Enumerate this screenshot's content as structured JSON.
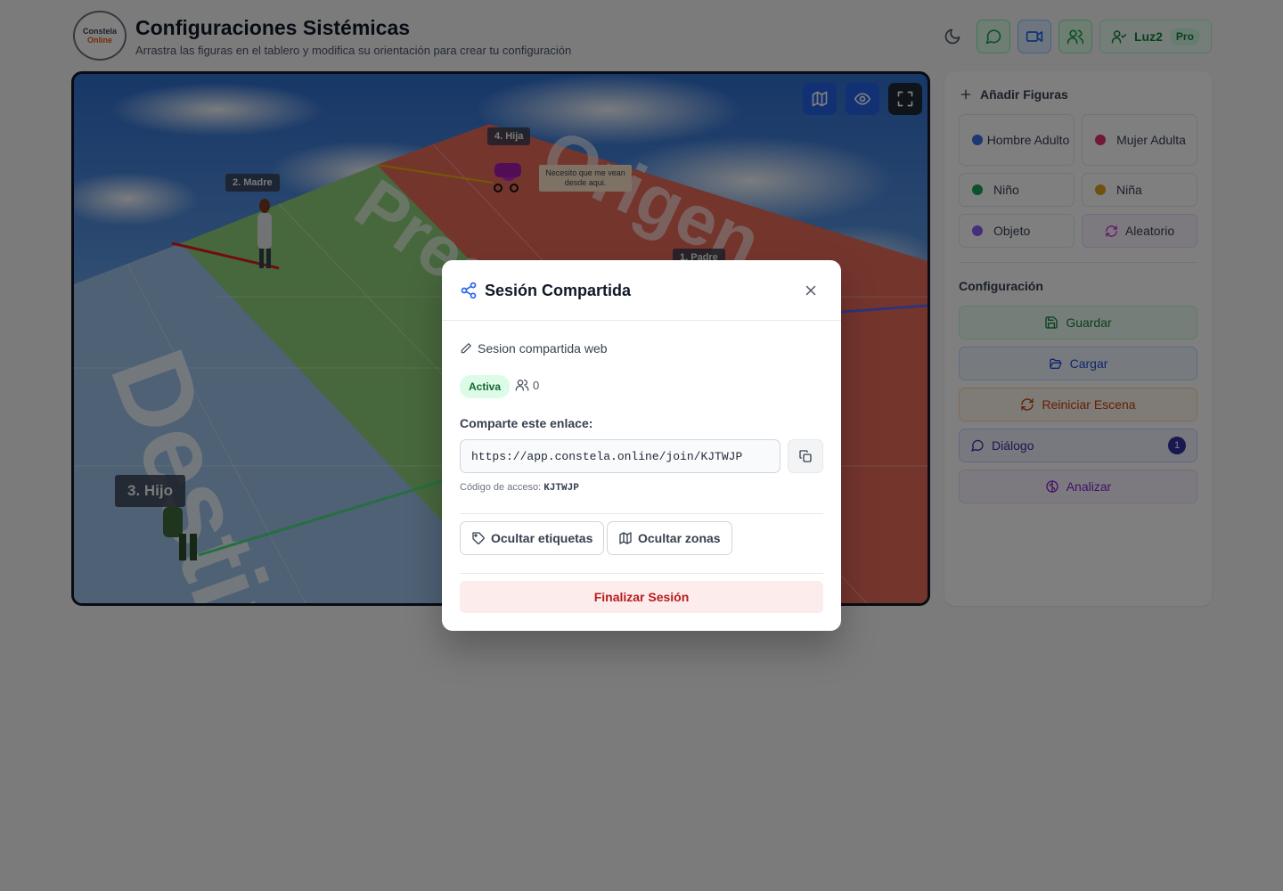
{
  "header": {
    "logo_top": "Constela",
    "logo_bottom": "Online",
    "title": "Configuraciones Sistémicas",
    "subtitle": "Arrastra las figuras en el tablero y modifica su orientación para crear tu configuración",
    "user_name": "Luz2",
    "plan_badge": "Pro"
  },
  "scene": {
    "labels": {
      "madre": "2. Madre",
      "hija": "4. Hija",
      "padre": "1. Padre",
      "hijo": "3. Hijo"
    },
    "note": "Necesito que me vean desde aqui.",
    "zone_words": {
      "origen": "Origen",
      "presente": "Presente",
      "destino": "Destino"
    }
  },
  "sidebar": {
    "add_title": "Añadir Figuras",
    "figures": [
      {
        "label": "Hombre Adulto",
        "color": "#3b6fe0"
      },
      {
        "label": "Mujer Adulta",
        "color": "#e0356f"
      },
      {
        "label": "Niño",
        "color": "#1aa05a"
      },
      {
        "label": "Niña",
        "color": "#e0a020"
      },
      {
        "label": "Objeto",
        "color": "#8b5cf6"
      },
      {
        "label": "Aleatorio",
        "color": "#c026d3"
      }
    ],
    "config_title": "Configuración",
    "actions": {
      "save": "Guardar",
      "load": "Cargar",
      "reset": "Reiniciar Escena",
      "dialog": "Diálogo",
      "dialog_count": "1",
      "analyze": "Analizar"
    }
  },
  "modal": {
    "title": "Sesión Compartida",
    "session_name": "Sesion compartida web",
    "status": "Activa",
    "participants": "0",
    "share_label": "Comparte este enlace:",
    "link": "https://app.constela.online/join/KJTWJP",
    "code_label": "Código de acceso:",
    "code": "KJTWJP",
    "hide_labels": "Ocultar etiquetas",
    "hide_zones": "Ocultar zonas",
    "end_session": "Finalizar Sesión"
  }
}
